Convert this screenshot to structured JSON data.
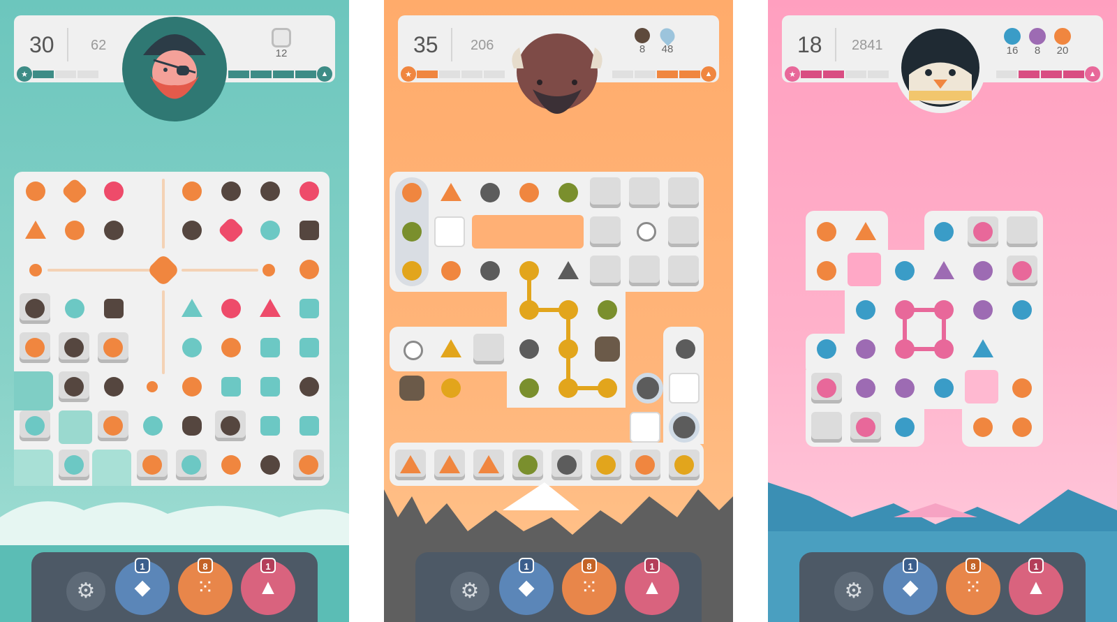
{
  "screens": [
    {
      "hud": {
        "moves": "30",
        "score": "62",
        "goals": [
          {
            "icon": "ice-icon",
            "count": "12"
          }
        ]
      },
      "avatar": "pirate-avatar-icon",
      "boosters": [
        {
          "icon": "eraser-icon",
          "count": "1"
        },
        {
          "icon": "expander-icon",
          "count": "8"
        },
        {
          "icon": "shuffle-icon",
          "count": "1"
        }
      ]
    },
    {
      "hud": {
        "moves": "35",
        "score": "206",
        "goals": [
          {
            "icon": "rock-icon",
            "count": "8"
          },
          {
            "icon": "water-drop-icon",
            "count": "48"
          }
        ]
      },
      "avatar": "bison-avatar-icon",
      "boosters": [
        {
          "icon": "eraser-icon",
          "count": "1"
        },
        {
          "icon": "expander-icon",
          "count": "8"
        },
        {
          "icon": "shuffle-icon",
          "count": "1"
        }
      ]
    },
    {
      "hud": {
        "moves": "18",
        "score": "2841",
        "goals": [
          {
            "icon": "blue-dot-icon",
            "count": "16"
          },
          {
            "icon": "purple-dot-icon",
            "count": "8"
          },
          {
            "icon": "orange-dot-icon",
            "count": "20"
          }
        ]
      },
      "avatar": "penguin-avatar-icon",
      "boosters": [
        {
          "icon": "eraser-icon",
          "count": "1"
        },
        {
          "icon": "expander-icon",
          "count": "8"
        },
        {
          "icon": "shuffle-icon",
          "count": "1"
        }
      ]
    }
  ],
  "colors": {
    "orange": "#f0863f",
    "red": "#ee4b6a",
    "dark": "#55463f",
    "teal": "#6cc8c4",
    "pink": "#e8689a",
    "blue": "#3a9cc7",
    "purple": "#9d6bb3",
    "green": "#7a8f2d",
    "yellow": "#e2a51c",
    "charcoal": "#5c5c5c"
  }
}
